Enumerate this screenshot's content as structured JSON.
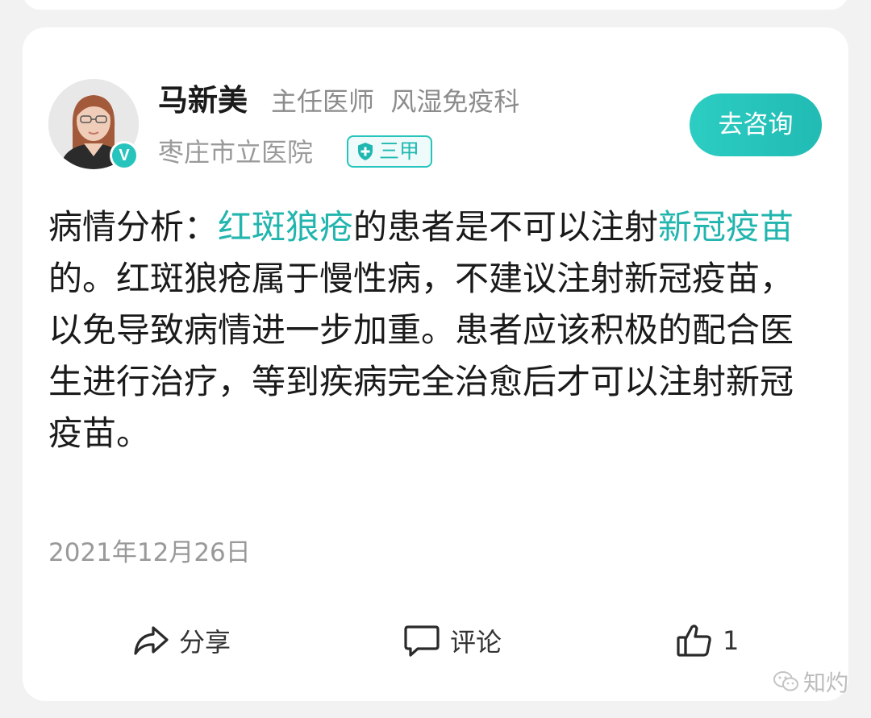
{
  "doctor": {
    "name": "马新美",
    "title": "主任医师  风湿免疫科",
    "hospital": "枣庄市立医院",
    "grade_badge": "三甲",
    "verified_mark": "V"
  },
  "consult_button_label": "去咨询",
  "analysis": {
    "segments": [
      {
        "text": "病情分析：",
        "link": false
      },
      {
        "text": "红斑狼疮",
        "link": true
      },
      {
        "text": "的患者是不可以注射",
        "link": false
      },
      {
        "text": "新冠疫苗",
        "link": true
      },
      {
        "text": "的。红斑狼疮属于慢性病，不建议注射新冠疫苗，以免导致病情进一步加重。患者应该积极的配合医生进行治疗，等到疾病完全治愈后才可以注射新冠疫苗。",
        "link": false
      }
    ]
  },
  "post_date": "2021年12月26日",
  "actions": {
    "share_label": "分享",
    "comment_label": "评论",
    "like_count": "1"
  },
  "watermark_text": "知灼",
  "icons": {
    "verified": "verified-v-icon",
    "grade": "shield-plus-icon",
    "share": "share-arrow-icon",
    "comment": "comment-bubble-icon",
    "like": "thumbs-up-icon",
    "watermark": "wechat-icon"
  },
  "colors": {
    "accent": "#22b5ae",
    "button_gradient_start": "#2ccdc2",
    "button_gradient_end": "#21bbb4",
    "text_primary": "#1a1a1a",
    "text_secondary": "#8c8c8c",
    "background": "#f2f2f2"
  }
}
